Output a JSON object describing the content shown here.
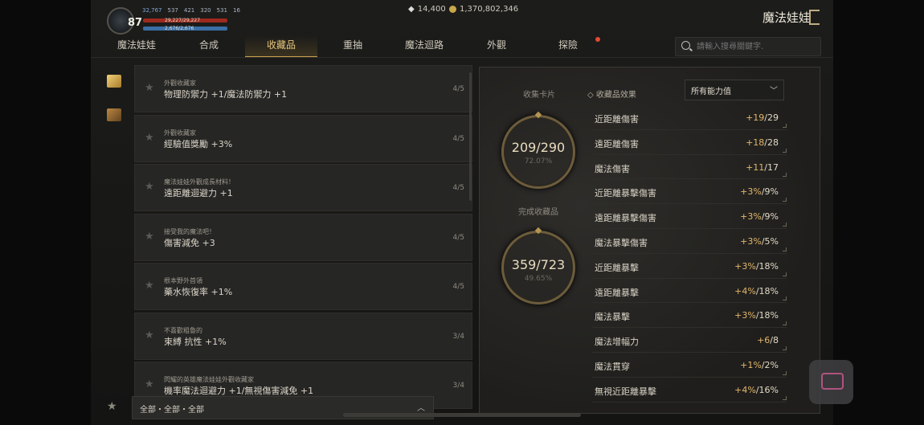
{
  "hud": {
    "level": "87",
    "stats": [
      "32,767",
      "537",
      "421",
      "320",
      "531",
      "16"
    ],
    "hp_text": "29,227/29,227",
    "mp_text": "2,676/2,676",
    "gems": "14,400",
    "gold": "1,370,802,346"
  },
  "app_title": "魔法娃娃",
  "tabs": [
    "魔法娃娃",
    "合成",
    "收藏品",
    "重抽",
    "魔法迴路",
    "外觀",
    "探險"
  ],
  "active_tab": "收藏品",
  "search": {
    "placeholder": "請輸入搜尋關鍵字."
  },
  "collections": [
    {
      "subtitle": "外觀收藏家",
      "effect": "物理防禦力 +1/魔法防禦力 +1",
      "count": "4/5"
    },
    {
      "subtitle": "外觀收藏家",
      "effect": "經驗值獎勵 +3%",
      "count": "4/5"
    },
    {
      "subtitle": "魔法娃娃外觀成長材料！",
      "effect": "遠距離迴避力 +1",
      "count": "4/5"
    },
    {
      "subtitle": "接受我的魔法吧！",
      "effect": "傷害減免 +3",
      "count": "4/5"
    },
    {
      "subtitle": "根本野外首領",
      "effect": "藥水恢復率 +1%",
      "count": "4/5"
    },
    {
      "subtitle": "不喜歡粗魯的",
      "effect": "束縛 抗性 +1%",
      "count": "3/4"
    },
    {
      "subtitle": "閃耀的英雄魔法娃娃外觀收藏家",
      "effect": "機率魔法迴避力 +1/無視傷害減免 +1",
      "count": "3/4"
    }
  ],
  "filter": {
    "label": "全部・全部・全部"
  },
  "summary": {
    "cards_label": "收集卡片",
    "cards_value": "209/290",
    "cards_pct": "72.07%",
    "done_label": "完成收藏品",
    "done_value": "359/723",
    "done_pct": "49.65%",
    "effects_label": "收藏品效果",
    "select_value": "所有能力值"
  },
  "effects": [
    {
      "name": "近距離傷害",
      "gain": "+19",
      "cap": "/29"
    },
    {
      "name": "遠距離傷害",
      "gain": "+18",
      "cap": "/28"
    },
    {
      "name": "魔法傷害",
      "gain": "+11",
      "cap": "/17"
    },
    {
      "name": "近距離暴擊傷害",
      "gain": "+3%",
      "cap": "/9%"
    },
    {
      "name": "遠距離暴擊傷害",
      "gain": "+3%",
      "cap": "/9%"
    },
    {
      "name": "魔法暴擊傷害",
      "gain": "+3%",
      "cap": "/5%"
    },
    {
      "name": "近距離暴擊",
      "gain": "+3%",
      "cap": "/18%"
    },
    {
      "name": "遠距離暴擊",
      "gain": "+4%",
      "cap": "/18%"
    },
    {
      "name": "魔法暴擊",
      "gain": "+3%",
      "cap": "/18%"
    },
    {
      "name": "魔法增幅力",
      "gain": "+6",
      "cap": "/8"
    },
    {
      "name": "魔法貫穿",
      "gain": "+1%",
      "cap": "/2%"
    },
    {
      "name": "無視近距離暴擊",
      "gain": "+4%",
      "cap": "/16%"
    }
  ]
}
